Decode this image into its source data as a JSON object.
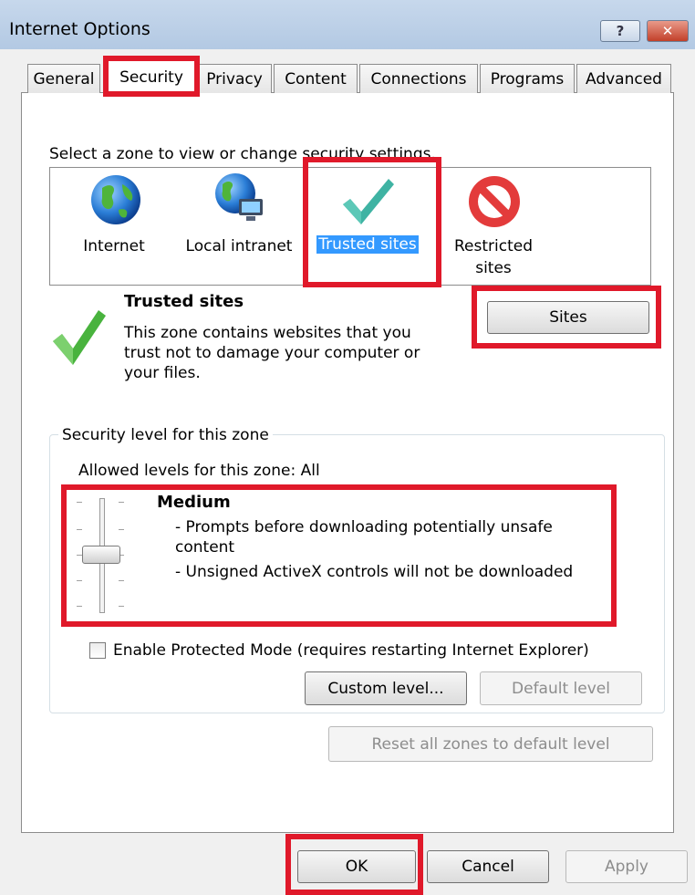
{
  "window": {
    "title": "Internet Options",
    "help_label": "?",
    "close_label": "✕"
  },
  "tabs": [
    {
      "label": "General"
    },
    {
      "label": "Security"
    },
    {
      "label": "Privacy"
    },
    {
      "label": "Content"
    },
    {
      "label": "Connections"
    },
    {
      "label": "Programs"
    },
    {
      "label": "Advanced"
    }
  ],
  "security": {
    "zone_prompt": "Select a zone to view or change security settings.",
    "zones": [
      {
        "label": "Internet",
        "icon": "globe-icon"
      },
      {
        "label": "Local intranet",
        "icon": "network-globe-icon"
      },
      {
        "label": "Trusted sites",
        "icon": "checkmark-icon",
        "selected": true
      },
      {
        "label": "Restricted sites",
        "icon": "prohibited-icon"
      }
    ],
    "selected_zone": {
      "name": "Trusted sites",
      "description": "This zone contains websites that you trust not to damage your computer or your files."
    },
    "sites_button": "Sites",
    "level_group_title": "Security level for this zone",
    "allowed_levels": "Allowed levels for this zone: All",
    "level": {
      "name": "Medium",
      "bullet1": "- Prompts before downloading potentially unsafe content",
      "bullet2": "- Unsigned ActiveX controls will not be downloaded",
      "slider_position": "3 of 5"
    },
    "protected_mode": {
      "label": "Enable Protected Mode (requires restarting Internet Explorer)",
      "checked": false
    },
    "custom_level_button": "Custom level...",
    "default_level_button": "Default level",
    "reset_all_button": "Reset all zones to default level"
  },
  "footer": {
    "ok": "OK",
    "cancel": "Cancel",
    "apply": "Apply"
  },
  "colors": {
    "highlight": "#e0192a",
    "selection": "#3399ff"
  }
}
